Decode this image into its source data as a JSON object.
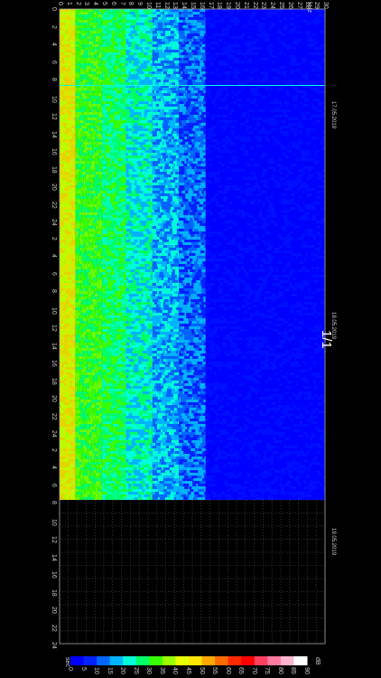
{
  "header": {
    "unit": "kHz"
  },
  "frequency_ticks": [
    "0",
    "1",
    "2",
    "3",
    "4",
    "5",
    "6",
    "7",
    "8",
    "9",
    "10",
    "11",
    "12",
    "13",
    "14",
    "15",
    "16",
    "17",
    "18",
    "19",
    "20",
    "21",
    "22",
    "23",
    "24",
    "25",
    "26",
    "27",
    "28",
    "29",
    "30"
  ],
  "time_ticks": [
    "0",
    "2",
    "4",
    "6",
    "8",
    "10",
    "12",
    "14",
    "16",
    "18",
    "20",
    "22",
    "24",
    "2",
    "4",
    "6",
    "8",
    "10",
    "12",
    "14",
    "16",
    "18",
    "20",
    "22",
    "24",
    "2",
    "4",
    "6",
    "8",
    "10",
    "12",
    "14",
    "16",
    "18",
    "20",
    "22",
    "24"
  ],
  "dates": [
    "17.05.2019",
    "18.05.2019",
    "19.05.2019"
  ],
  "page_indicator": "1/1",
  "footer": {
    "left_unit": "sec",
    "scale_unit": "dB",
    "scale_ticks": [
      "0",
      "5",
      "10",
      "15",
      "20",
      "25",
      "30",
      "35",
      "40",
      "45",
      "50",
      "55",
      "60",
      "65",
      "70",
      "75",
      "80",
      "85",
      "90"
    ],
    "scale_colors": [
      "#0000ff",
      "#0022ff",
      "#0066ff",
      "#00b4ff",
      "#00ffd8",
      "#00ff66",
      "#39ff00",
      "#9cff00",
      "#e8ff00",
      "#ffe600",
      "#ffa800",
      "#ff6a00",
      "#ff2a00",
      "#ff0000",
      "#ff4060",
      "#ff7aa0",
      "#ffb6cc",
      "#ffffff"
    ]
  },
  "colors": {
    "background": "#000000",
    "plot_background": "#0000ff",
    "grid": "#666666"
  }
}
